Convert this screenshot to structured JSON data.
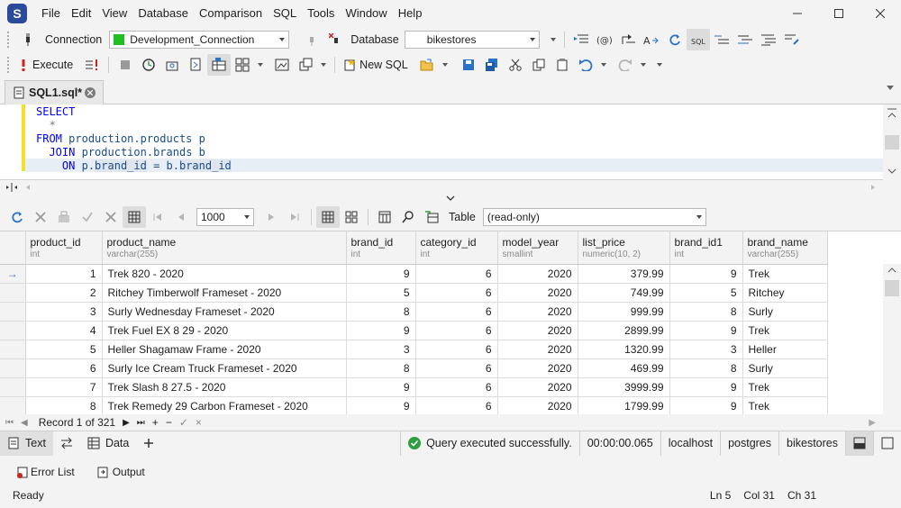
{
  "app": {
    "logo_letter": "S",
    "menu": [
      "File",
      "Edit",
      "View",
      "Database",
      "Comparison",
      "SQL",
      "Tools",
      "Window",
      "Help"
    ]
  },
  "toolbar1": {
    "connection_label": "Connection",
    "connection_value": "Development_Connection",
    "database_label": "Database",
    "database_value": "bikestores"
  },
  "toolbar2": {
    "execute_label": "Execute",
    "new_sql_label": "New SQL"
  },
  "document_tab": {
    "title": "SQL1.sql*"
  },
  "editor": {
    "lines": [
      "SELECT",
      "  *",
      "FROM production.products p",
      "  JOIN production.brands b",
      "    ON p.brand_id = b.brand_id"
    ]
  },
  "grid_toolbar": {
    "page_size": "1000",
    "view_label": "Table",
    "view_mode": "(read-only)"
  },
  "grid": {
    "columns": [
      {
        "name": "product_id",
        "type": "int"
      },
      {
        "name": "product_name",
        "type": "varchar(255)"
      },
      {
        "name": "brand_id",
        "type": "int"
      },
      {
        "name": "category_id",
        "type": "int"
      },
      {
        "name": "model_year",
        "type": "smallint"
      },
      {
        "name": "list_price",
        "type": "numeric(10, 2)"
      },
      {
        "name": "brand_id1",
        "type": "int"
      },
      {
        "name": "brand_name",
        "type": "varchar(255)"
      }
    ],
    "rows": [
      [
        "1",
        "Trek 820 - 2020",
        "9",
        "6",
        "2020",
        "379.99",
        "9",
        "Trek"
      ],
      [
        "2",
        "Ritchey Timberwolf Frameset - 2020",
        "5",
        "6",
        "2020",
        "749.99",
        "5",
        "Ritchey"
      ],
      [
        "3",
        "Surly Wednesday Frameset - 2020",
        "8",
        "6",
        "2020",
        "999.99",
        "8",
        "Surly"
      ],
      [
        "4",
        "Trek Fuel EX 8 29 - 2020",
        "9",
        "6",
        "2020",
        "2899.99",
        "9",
        "Trek"
      ],
      [
        "5",
        "Heller Shagamaw Frame - 2020",
        "3",
        "6",
        "2020",
        "1320.99",
        "3",
        "Heller"
      ],
      [
        "6",
        "Surly Ice Cream Truck Frameset - 2020",
        "8",
        "6",
        "2020",
        "469.99",
        "8",
        "Surly"
      ],
      [
        "7",
        "Trek Slash 8 27.5 - 2020",
        "9",
        "6",
        "2020",
        "3999.99",
        "9",
        "Trek"
      ],
      [
        "8",
        "Trek Remedy 29 Carbon Frameset - 2020",
        "9",
        "6",
        "2020",
        "1799.99",
        "9",
        "Trek"
      ]
    ]
  },
  "record_nav": {
    "record_text": "Record 1 of 321"
  },
  "result_tabs": {
    "text_label": "Text",
    "data_label": "Data"
  },
  "result_status": {
    "message": "Query executed successfully.",
    "elapsed": "00:00:00.065",
    "server": "localhost",
    "user": "postgres",
    "database": "bikestores"
  },
  "panels": {
    "error_list": "Error List",
    "output": "Output"
  },
  "statusbar": {
    "state": "Ready",
    "line": "Ln 5",
    "col": "Col 31",
    "ch": "Ch 31"
  },
  "colors": {
    "keyword": "#0000ff",
    "identifier": "#1a4c8c",
    "connection_dev": "#1fc01f",
    "success": "#2e9e3e",
    "accent": "#2a72c8"
  }
}
